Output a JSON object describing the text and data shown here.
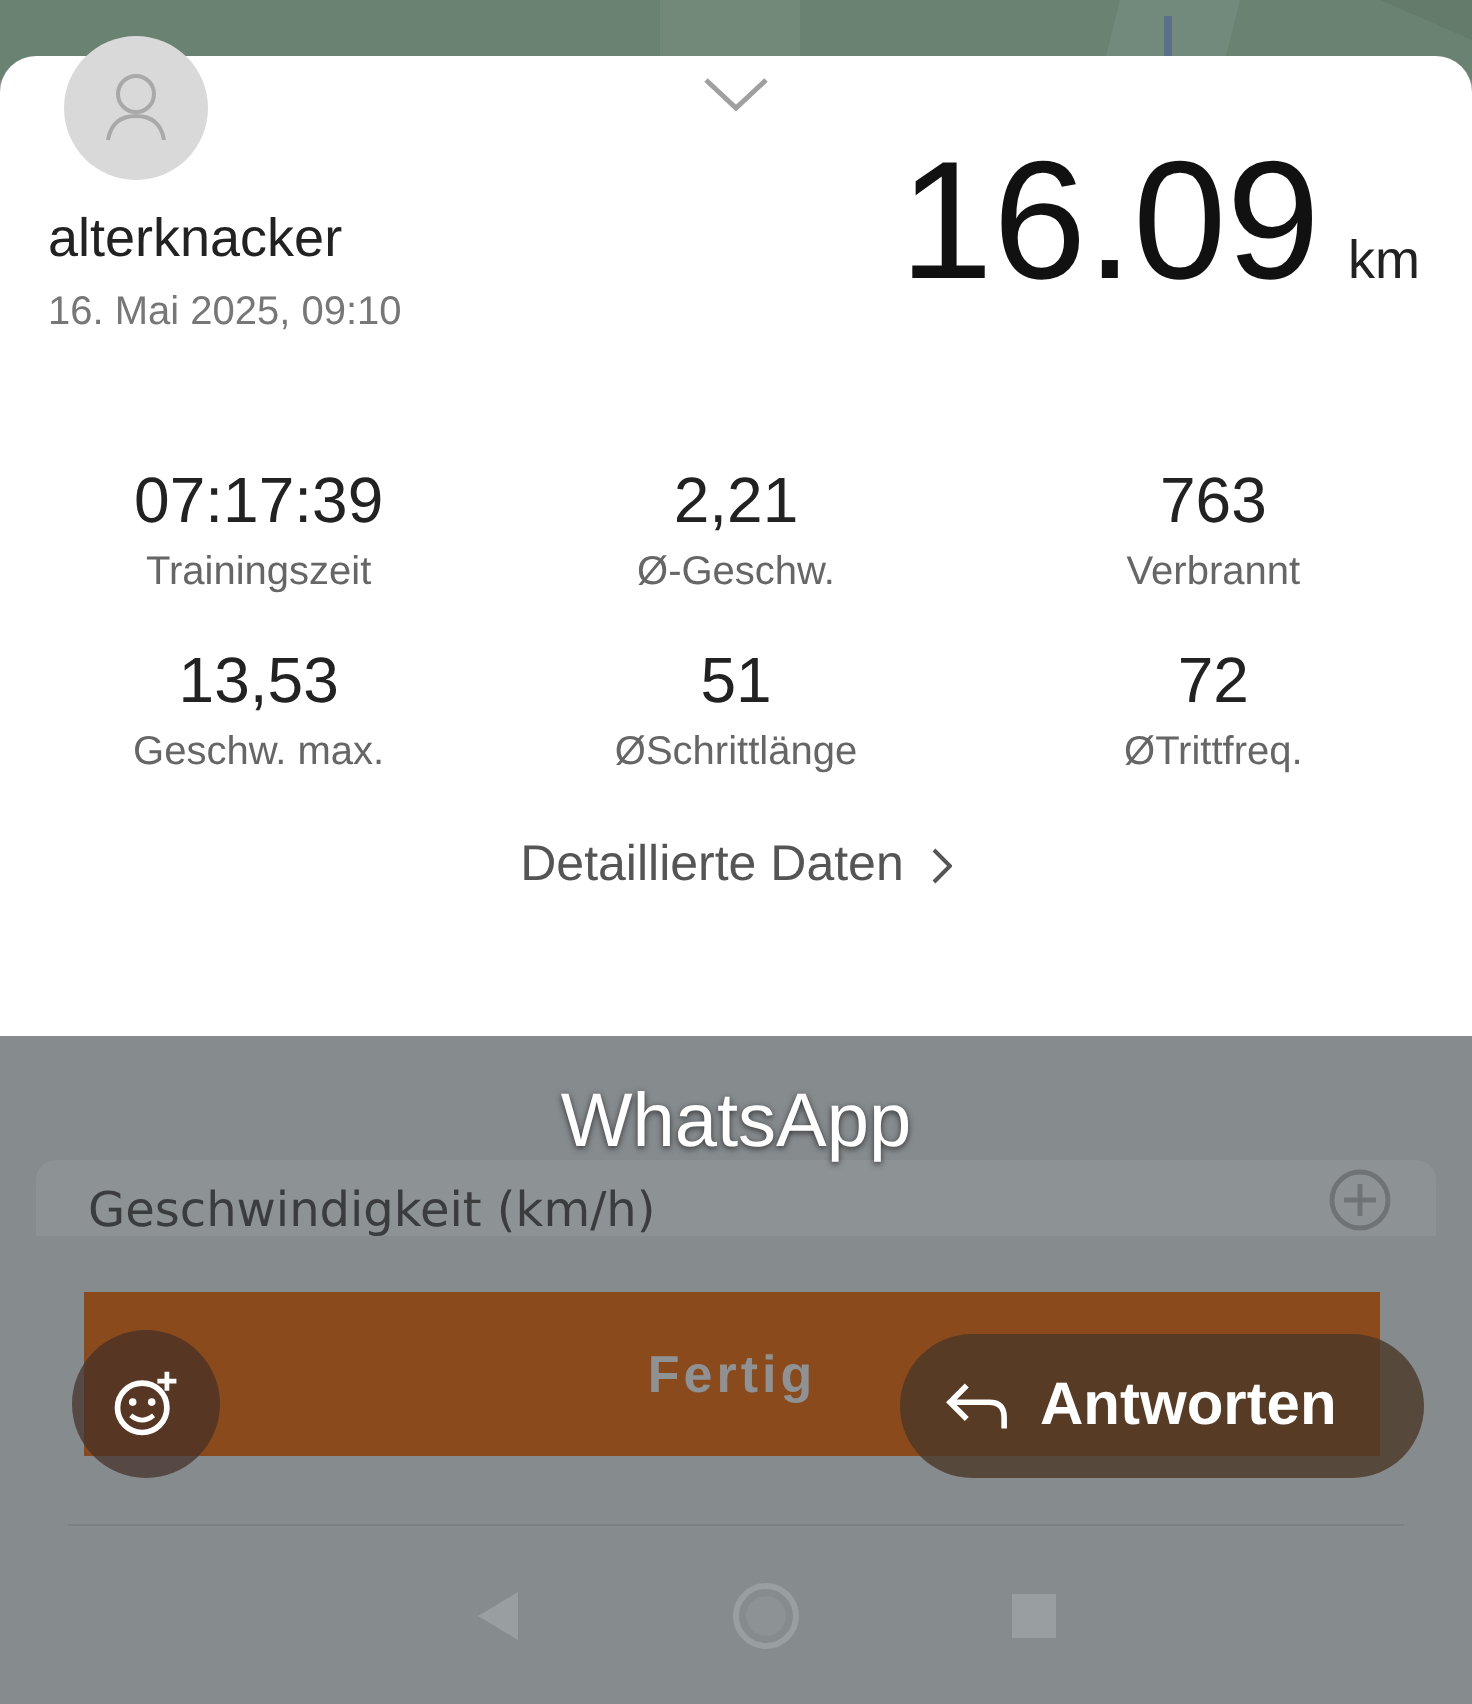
{
  "workout": {
    "user": "alterknacker",
    "date": "16. Mai 2025, 09:10",
    "distance": "16.09",
    "distance_unit": "km"
  },
  "stats": [
    {
      "value": "07:17:39",
      "label": "Trainingszeit"
    },
    {
      "value": "2,21",
      "label": "Ø-Geschw."
    },
    {
      "value": "763",
      "label": "Verbrannt"
    },
    {
      "value": "13,53",
      "label": "Geschw. max."
    },
    {
      "value": "51",
      "label": "ØSchrittlänge"
    },
    {
      "value": "72",
      "label": "ØTrittfreq."
    }
  ],
  "details_link": "Detaillierte Daten",
  "overlay": {
    "title": "WhatsApp",
    "chart_title": "Geschwindigkeit (km/h)",
    "done_button": "Fertig",
    "reply_button": "Antworten"
  }
}
